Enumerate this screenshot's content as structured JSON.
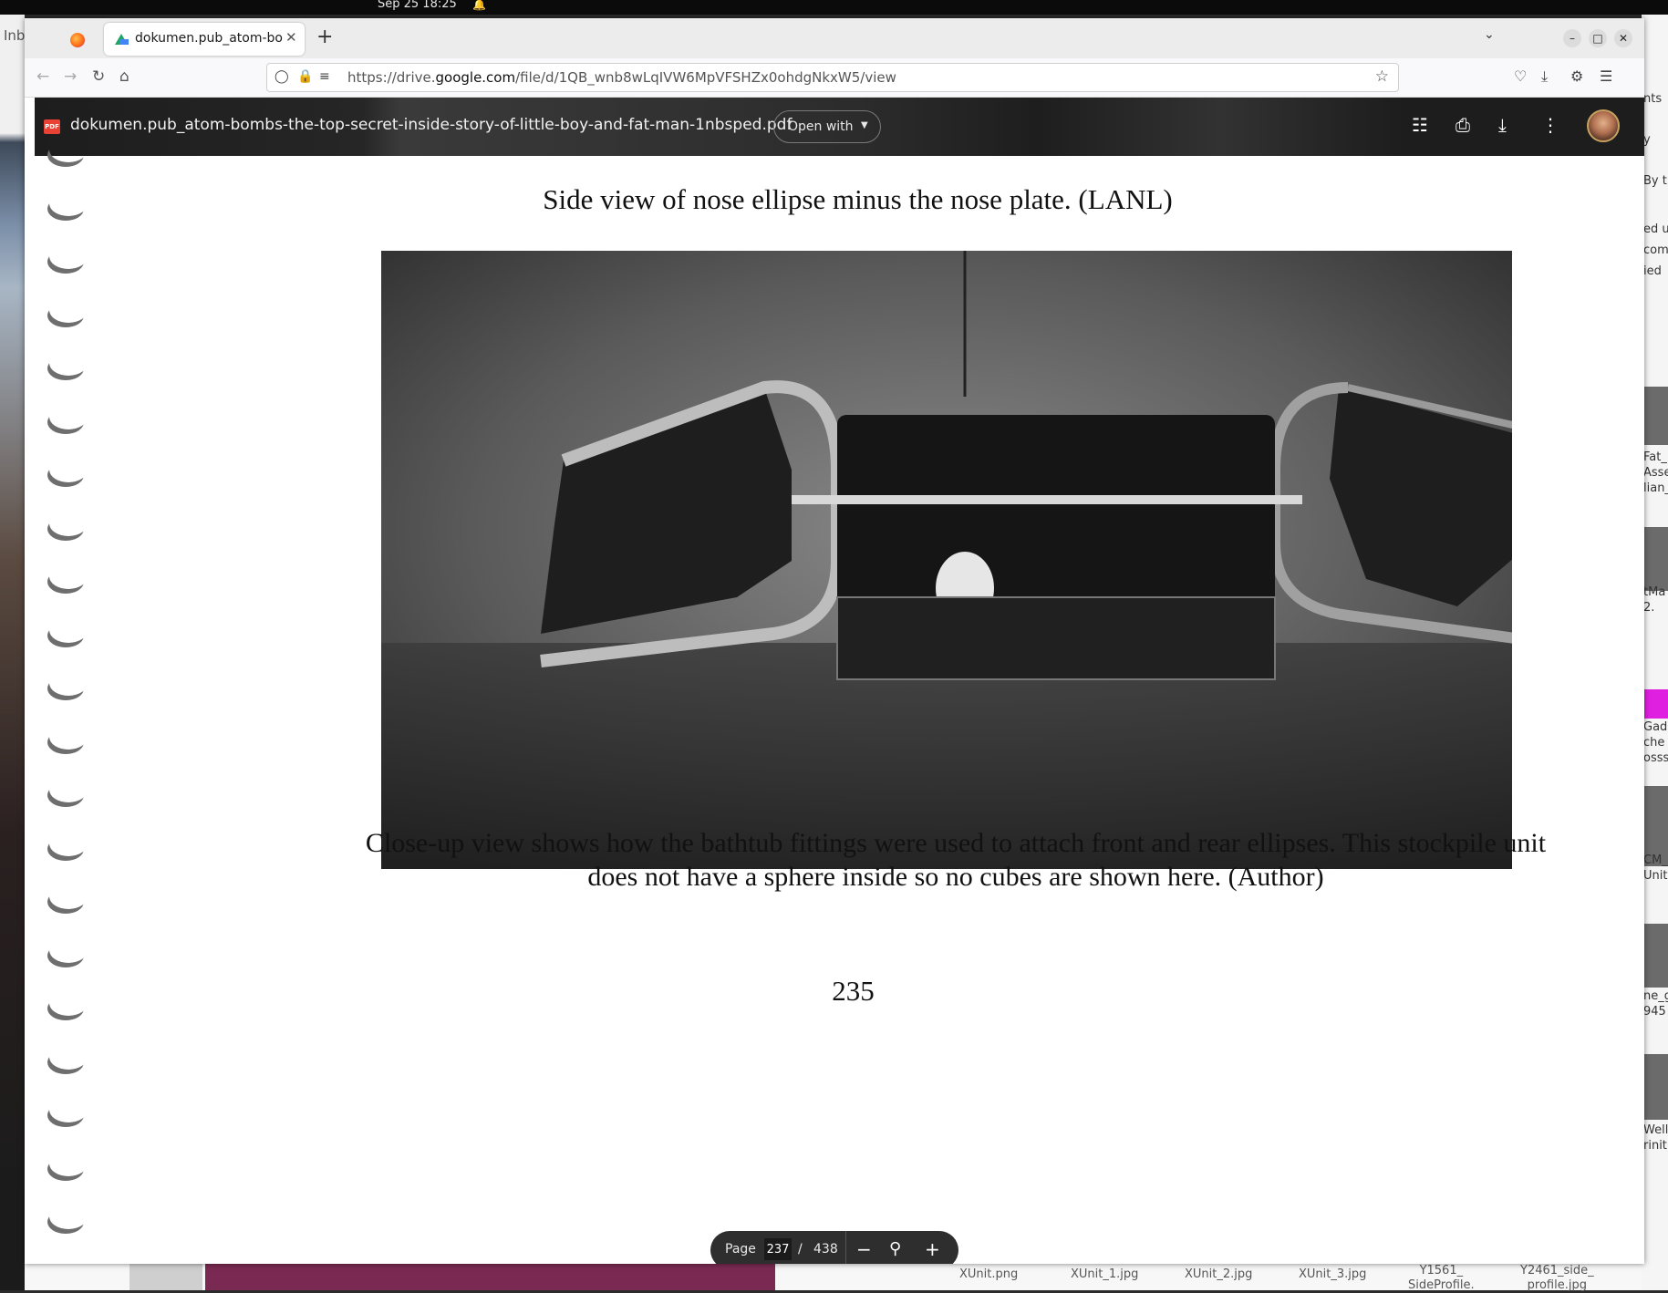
{
  "system": {
    "clock": "Sep 25  18:25"
  },
  "desktop": {
    "left_fragment": "Inb",
    "right_fragments": [
      "nts",
      "y",
      "By th",
      "ed u",
      "com",
      "ied",
      "Fat_",
      "Asse",
      "lian_",
      "tMa",
      "2.",
      "Gad",
      "che",
      "osss",
      "CM_",
      "Unit",
      "ne_g",
      "945",
      "Welle",
      "rinit"
    ],
    "bottom_files": [
      "XUnit.png",
      "XUnit_1.jpg",
      "XUnit_2.jpg",
      "XUnit_3.jpg",
      "Y1561_\nSideProfile.",
      "Y2461_side_\nprofile.jpg"
    ]
  },
  "browser": {
    "tab_title": "dokumen.pub_atom-bombs-the-top-secret-inside-story-of-little-boy-and-fat-man-1nbsped.pdf",
    "url_prefix": "https://drive.",
    "url_domain": "google.com",
    "url_rest": "/file/d/1QB_wnb8wLqIVW6MpVFSHZx0ohdgNkxW5/view"
  },
  "drive": {
    "file_name": "dokumen.pub_atom-bombs-the-top-secret-inside-story-of-little-boy-and-fat-man-1nbsped.pdf",
    "open_with_label": "Open with",
    "pdf_badge": "PDF"
  },
  "document": {
    "caption_top": "Side view of nose ellipse minus the nose plate.  (LANL)",
    "caption_bottom_line1": "Close-up view shows how the bathtub fittings were used to attach front and rear ellipses.  This stockpile unit",
    "caption_bottom_line2": "does not have a sphere inside so no cubes are shown here.  (Author)",
    "page_number": "235"
  },
  "page_control": {
    "label": "Page",
    "current_page": "237",
    "separator": "/",
    "total_pages": "438"
  }
}
